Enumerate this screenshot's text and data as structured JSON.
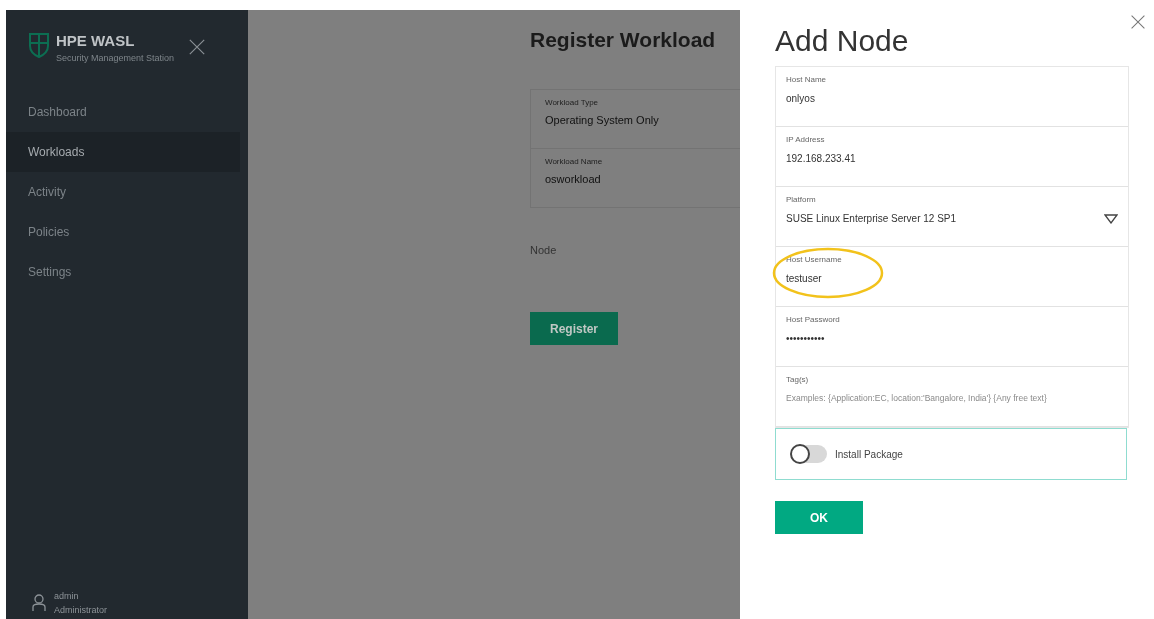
{
  "sidebar": {
    "title": "HPE WASL",
    "subtitle": "Security Management Station",
    "items": [
      {
        "label": "Dashboard",
        "selected": false
      },
      {
        "label": "Workloads",
        "selected": true
      },
      {
        "label": "Activity",
        "selected": false
      },
      {
        "label": "Policies",
        "selected": false
      },
      {
        "label": "Settings",
        "selected": false
      }
    ],
    "user": {
      "name": "admin",
      "role": "Administrator"
    }
  },
  "main": {
    "title": "Register Workload",
    "fields": [
      {
        "label": "Workload Type",
        "value": "Operating System Only"
      },
      {
        "label": "Workload Name",
        "value": "osworkload"
      }
    ],
    "node_label": "Node",
    "button": "Register"
  },
  "drawer": {
    "title": "Add Node",
    "fields": [
      {
        "kind": "text",
        "label": "Host Name",
        "value": "onlyos",
        "highlighted": false
      },
      {
        "kind": "text",
        "label": "IP Address",
        "value": "192.168.233.41",
        "highlighted": false
      },
      {
        "kind": "select",
        "label": "Platform",
        "value": "SUSE Linux Enterprise Server 12 SP1",
        "highlighted": false
      },
      {
        "kind": "text",
        "label": "Host Username",
        "value": "testuser",
        "highlighted": true
      },
      {
        "kind": "password",
        "label": "Host Password",
        "value": "•••••••••••",
        "highlighted": false
      },
      {
        "kind": "tags",
        "label": "Tag(s)",
        "placeholder": "Examples: {Application:EC, location:'Bangalore, India'} {Any free text}",
        "highlighted": false
      }
    ],
    "toggle": {
      "label": "Install Package",
      "on": false
    },
    "button": "OK"
  }
}
